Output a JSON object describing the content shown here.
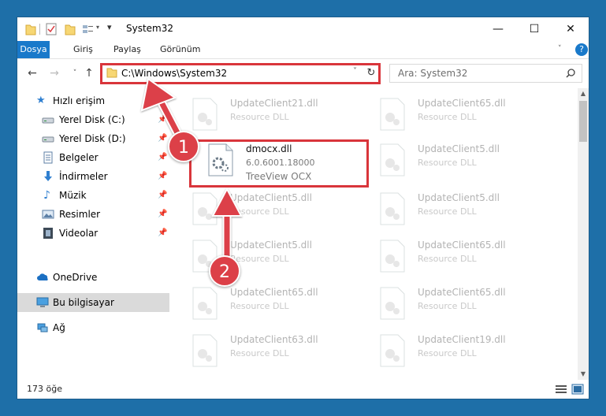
{
  "window": {
    "title": "System32",
    "controls": {
      "minimize_icon": "minimize-icon",
      "maximize_icon": "maximize-icon",
      "close_icon": "close-icon"
    }
  },
  "ribbon": {
    "tabs": [
      {
        "label": "Dosya",
        "active": true
      },
      {
        "label": "Giriş"
      },
      {
        "label": "Paylaş"
      },
      {
        "label": "Görünüm"
      }
    ],
    "help_icon": "?"
  },
  "navigation": {
    "address": "C:\\Windows\\System32",
    "search_placeholder": "Ara: System32"
  },
  "sidebar": {
    "items": [
      {
        "label": "Hızlı erişim",
        "icon": "star-icon"
      },
      {
        "label": "Yerel Disk (C:)",
        "icon": "drive-icon",
        "pinned": true
      },
      {
        "label": "Yerel Disk (D:)",
        "icon": "drive-icon",
        "pinned": true
      },
      {
        "label": "Belgeler",
        "icon": "documents-icon",
        "pinned": true
      },
      {
        "label": "İndirmeler",
        "icon": "download-icon",
        "pinned": true
      },
      {
        "label": "Müzik",
        "icon": "music-icon",
        "pinned": true
      },
      {
        "label": "Resimler",
        "icon": "pictures-icon",
        "pinned": true
      },
      {
        "label": "Videolar",
        "icon": "videos-icon",
        "pinned": true
      },
      {
        "label": "OneDrive",
        "icon": "cloud-icon"
      },
      {
        "label": "Bu bilgisayar",
        "icon": "computer-icon",
        "selected": true
      },
      {
        "label": "Ağ",
        "icon": "network-icon"
      }
    ]
  },
  "files": [
    {
      "name": "UpdateClient21.dll",
      "desc": "Resource DLL"
    },
    {
      "name": "UpdateClient65.dll",
      "desc": "Resource DLL"
    },
    {
      "name": "dmocx.dll",
      "desc": "6.0.6001.18000",
      "extra": "TreeView OCX",
      "highlighted": true
    },
    {
      "name": "UpdateClient5.dll",
      "desc": "Resource DLL"
    },
    {
      "name": "UpdateClient5.dll",
      "desc": "Resource DLL"
    },
    {
      "name": "UpdateClient5.dll",
      "desc": "Resource DLL"
    },
    {
      "name": "UpdateClient5.dll",
      "desc": "Resource DLL"
    },
    {
      "name": "UpdateClient65.dll",
      "desc": "Resource DLL"
    },
    {
      "name": "UpdateClient65.dll",
      "desc": "Resource DLL"
    },
    {
      "name": "UpdateClient65.dll",
      "desc": "Resource DLL"
    },
    {
      "name": "UpdateClient63.dll",
      "desc": "Resource DLL"
    },
    {
      "name": "UpdateClient19.dll",
      "desc": "Resource DLL"
    }
  ],
  "status": {
    "count": "173 öğe"
  },
  "annotations": {
    "step1": "1",
    "step2": "2",
    "color": "#dc4048"
  }
}
